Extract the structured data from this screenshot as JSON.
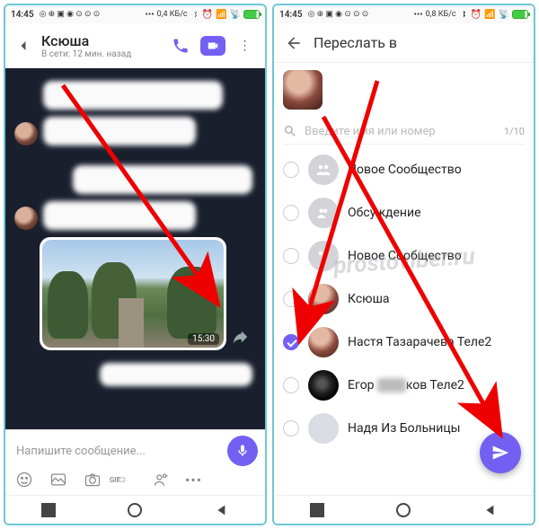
{
  "statusbar_time": "14:45",
  "left": {
    "kbs": "0,4 КБ/с",
    "chat_title": "Ксюша",
    "chat_status": "В сети: 12 мин. назад",
    "media_time": "15:30",
    "composer_placeholder": "Напишите сообщение..."
  },
  "right": {
    "kbs": "0,8 КБ/с",
    "fwd_title": "Переслать в",
    "search_placeholder": "Введите имя или номер",
    "counter": "1/10",
    "rows": [
      {
        "label": "Новое Сообщество",
        "checked": false,
        "icon": "community"
      },
      {
        "label": "Обсуждение",
        "checked": false,
        "icon": "group"
      },
      {
        "label": "Новое Сообщество",
        "checked": false,
        "icon": "community"
      },
      {
        "label": "Ксюша",
        "checked": false,
        "icon": "photo1"
      },
      {
        "label": "Настя Тазарачева Теле2",
        "checked": true,
        "icon": "photo1"
      },
      {
        "label": "Егор Сшшков Теле2",
        "checked": false,
        "icon": "photo2"
      },
      {
        "label": "Надя Из Больницы",
        "checked": false,
        "icon": "blurhead"
      }
    ]
  },
  "watermark": "prostoviber.ru"
}
